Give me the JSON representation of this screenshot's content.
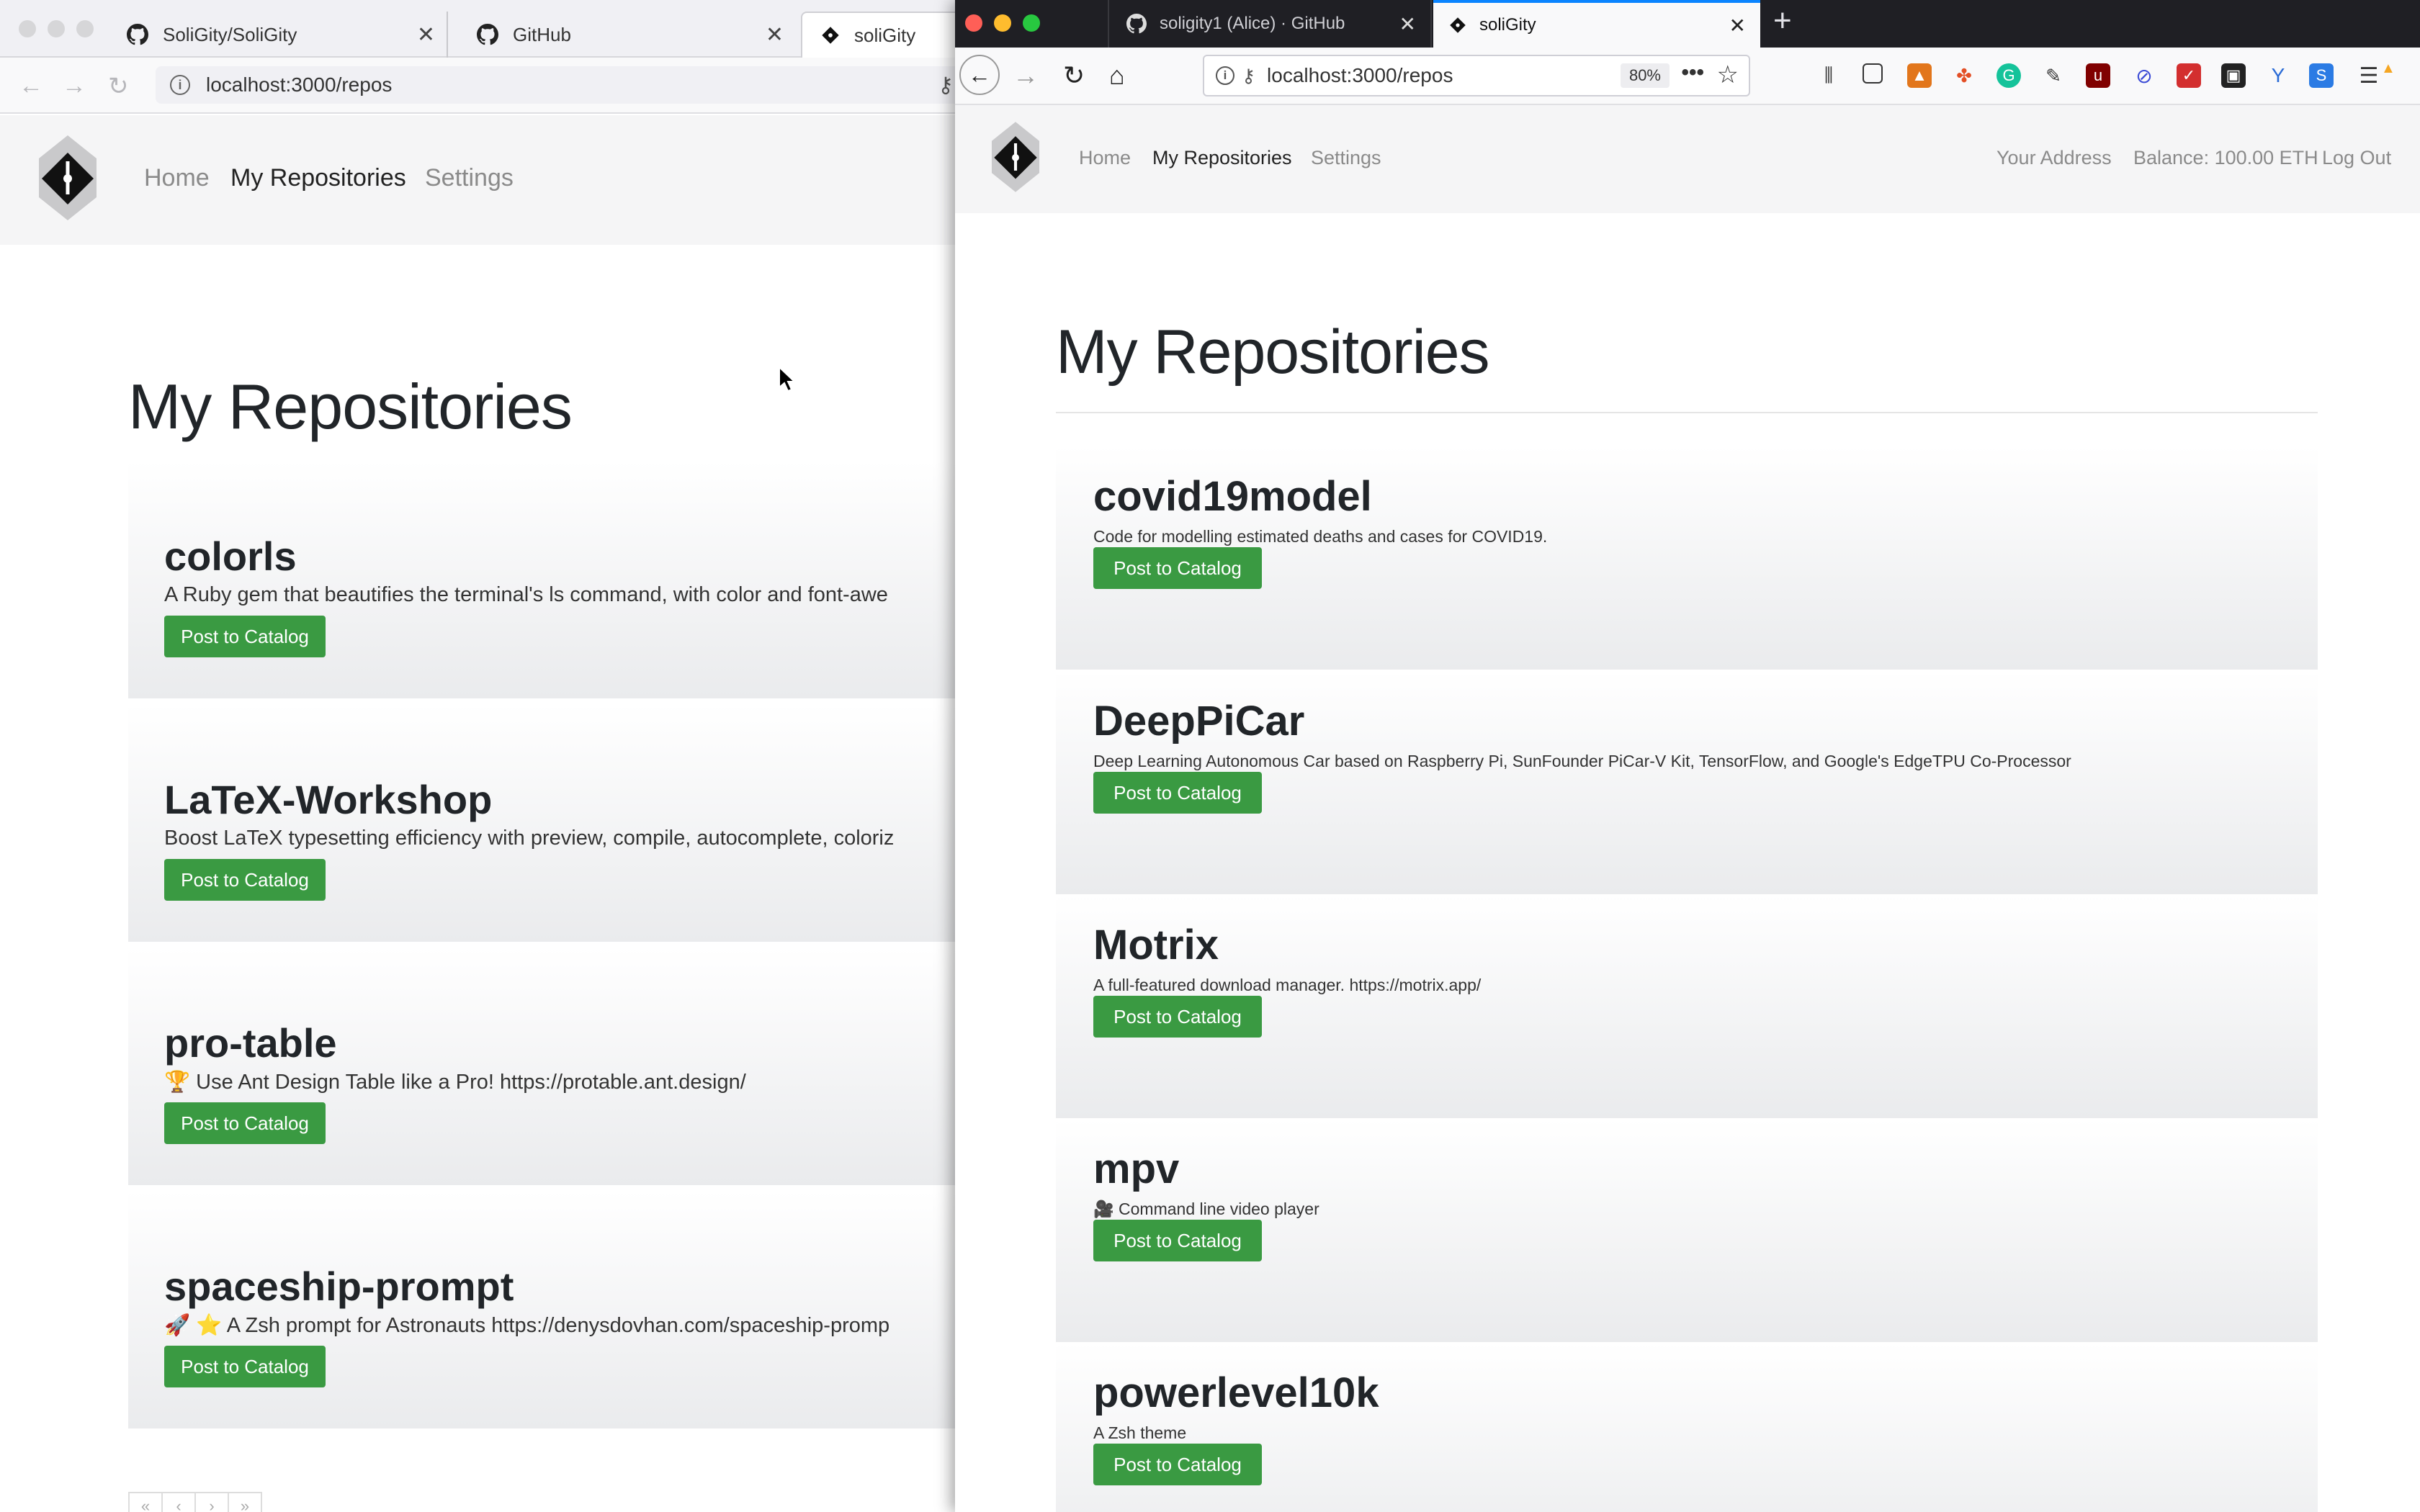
{
  "back_window": {
    "tabs": [
      {
        "label": "SoliGity/SoliGity"
      },
      {
        "label": "GitHub"
      },
      {
        "label": "soliGity"
      }
    ],
    "url": "localhost:3000/repos",
    "nav": {
      "home": "Home",
      "repos": "My Repositories",
      "settings": "Settings"
    },
    "page_title": "My Repositories",
    "repos": [
      {
        "name": "colorls",
        "description": "A Ruby gem that beautifies the terminal's ls command, with color and font-awe",
        "button": "Post to Catalog"
      },
      {
        "name": "LaTeX-Workshop",
        "description": "Boost LaTeX typesetting efficiency with preview, compile, autocomplete, coloriz",
        "button": "Post to Catalog"
      },
      {
        "name": "pro-table",
        "description": "🏆  Use Ant Design Table like a Pro! https://protable.ant.design/",
        "button": "Post to Catalog"
      },
      {
        "name": "spaceship-prompt",
        "description": "🚀 ⭐  A Zsh prompt for Astronauts https://denysdovhan.com/spaceship-promp",
        "button": "Post to Catalog"
      }
    ],
    "pager": [
      "«",
      "‹",
      "›",
      "»"
    ]
  },
  "front_window": {
    "tabs": [
      {
        "label": "soligity1 (Alice) · GitHub"
      },
      {
        "label": "soliGity"
      }
    ],
    "url": "localhost:3000/repos",
    "zoom": "80%",
    "nav": {
      "home": "Home",
      "repos": "My Repositories",
      "settings": "Settings"
    },
    "account": {
      "address": "Your Address",
      "balance": "Balance: 100.00 ETH",
      "logout": "Log Out"
    },
    "page_title": "My Repositories",
    "repos": [
      {
        "name": "covid19model",
        "description": "Code for modelling estimated deaths and cases for COVID19.",
        "button": "Post to Catalog"
      },
      {
        "name": "DeepPiCar",
        "description": "Deep Learning Autonomous Car based on Raspberry Pi, SunFounder PiCar-V Kit, TensorFlow, and Google's EdgeTPU Co-Processor",
        "button": "Post to Catalog"
      },
      {
        "name": "Motrix",
        "description": "A full-featured download manager. https://motrix.app/",
        "button": "Post to Catalog"
      },
      {
        "name": "mpv",
        "description": "🎥 Command line video player",
        "button": "Post to Catalog"
      },
      {
        "name": "powerlevel10k",
        "description": "A Zsh theme",
        "button": "Post to Catalog"
      }
    ]
  },
  "colors": {
    "accent_green": "#3a9a42",
    "tab_highlight": "#0a84ff",
    "dark_tabbar": "#1f1f24"
  }
}
